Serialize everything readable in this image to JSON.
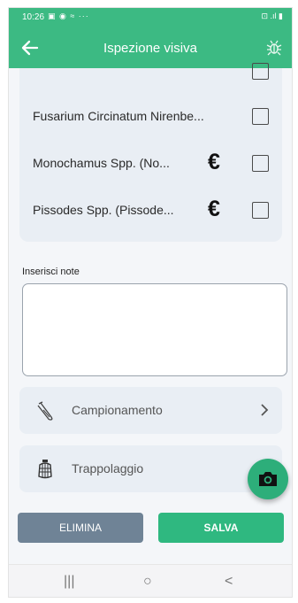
{
  "status_bar": {
    "time": "10:26",
    "left_icons": "▣ ◉ ≈ ···",
    "right_icons": "⊡ .ıl ▮"
  },
  "app_bar": {
    "title": "Ispezione visiva"
  },
  "species": [
    {
      "label": "Fusarium Circinatum Nirenbe...",
      "euro": "",
      "checked": false
    },
    {
      "label": "Monochamus Spp. (No...",
      "euro": "€",
      "checked": false
    },
    {
      "label": "Pissodes Spp. (Pissode...",
      "euro": "€",
      "checked": false
    }
  ],
  "notes": {
    "label": "Inserisci note",
    "value": ""
  },
  "options": [
    {
      "label": "Campionamento",
      "icon": "test-tube-icon",
      "has_chevron": true
    },
    {
      "label": "Trappolaggio",
      "icon": "trap-icon",
      "has_chevron": false
    }
  ],
  "buttons": {
    "delete": "ELIMINA",
    "save": "SALVA"
  },
  "navbar": {
    "recents": "|||",
    "home": "○",
    "back": "<"
  },
  "colors": {
    "primary": "#3cba83",
    "card": "#e9eef4",
    "delete": "#6f8396",
    "save": "#2fb880"
  }
}
